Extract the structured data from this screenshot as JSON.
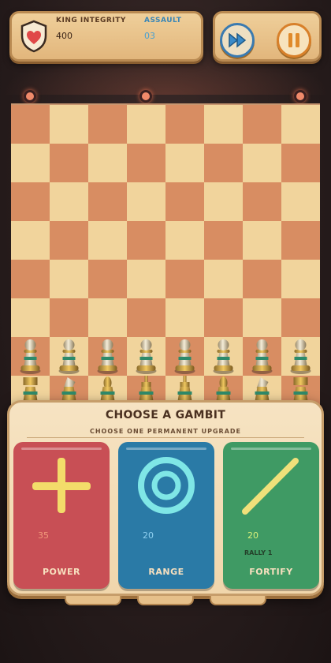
{
  "hud": {
    "king_label": "KING INTEGRITY",
    "king_value": "400",
    "assault_label": "ASSAULT",
    "assault_value": "03",
    "fast_forward_icon": "fast-forward-icon",
    "pause_icon": "pause-icon",
    "shield_icon": "heart-shield-icon"
  },
  "board": {
    "rows": 8,
    "cols": 8,
    "dark_color": "#d88d62",
    "light_color": "#f1d49c",
    "pawn_count": 8
  },
  "gambit": {
    "title": "CHOOSE A GAMBIT",
    "subtitle": "CHOOSE ONE PERMANENT UPGRADE",
    "cards": [
      {
        "name": "POWER",
        "value": "35",
        "icon": "plus-icon",
        "color": "#c84f55",
        "extra": ""
      },
      {
        "name": "RANGE",
        "value": "20",
        "icon": "target-icon",
        "color": "#2a7aa6",
        "extra": ""
      },
      {
        "name": "FORTIFY",
        "value": "20",
        "icon": "slash-icon",
        "color": "#3f9a64",
        "extra": "RALLY 1"
      }
    ]
  }
}
